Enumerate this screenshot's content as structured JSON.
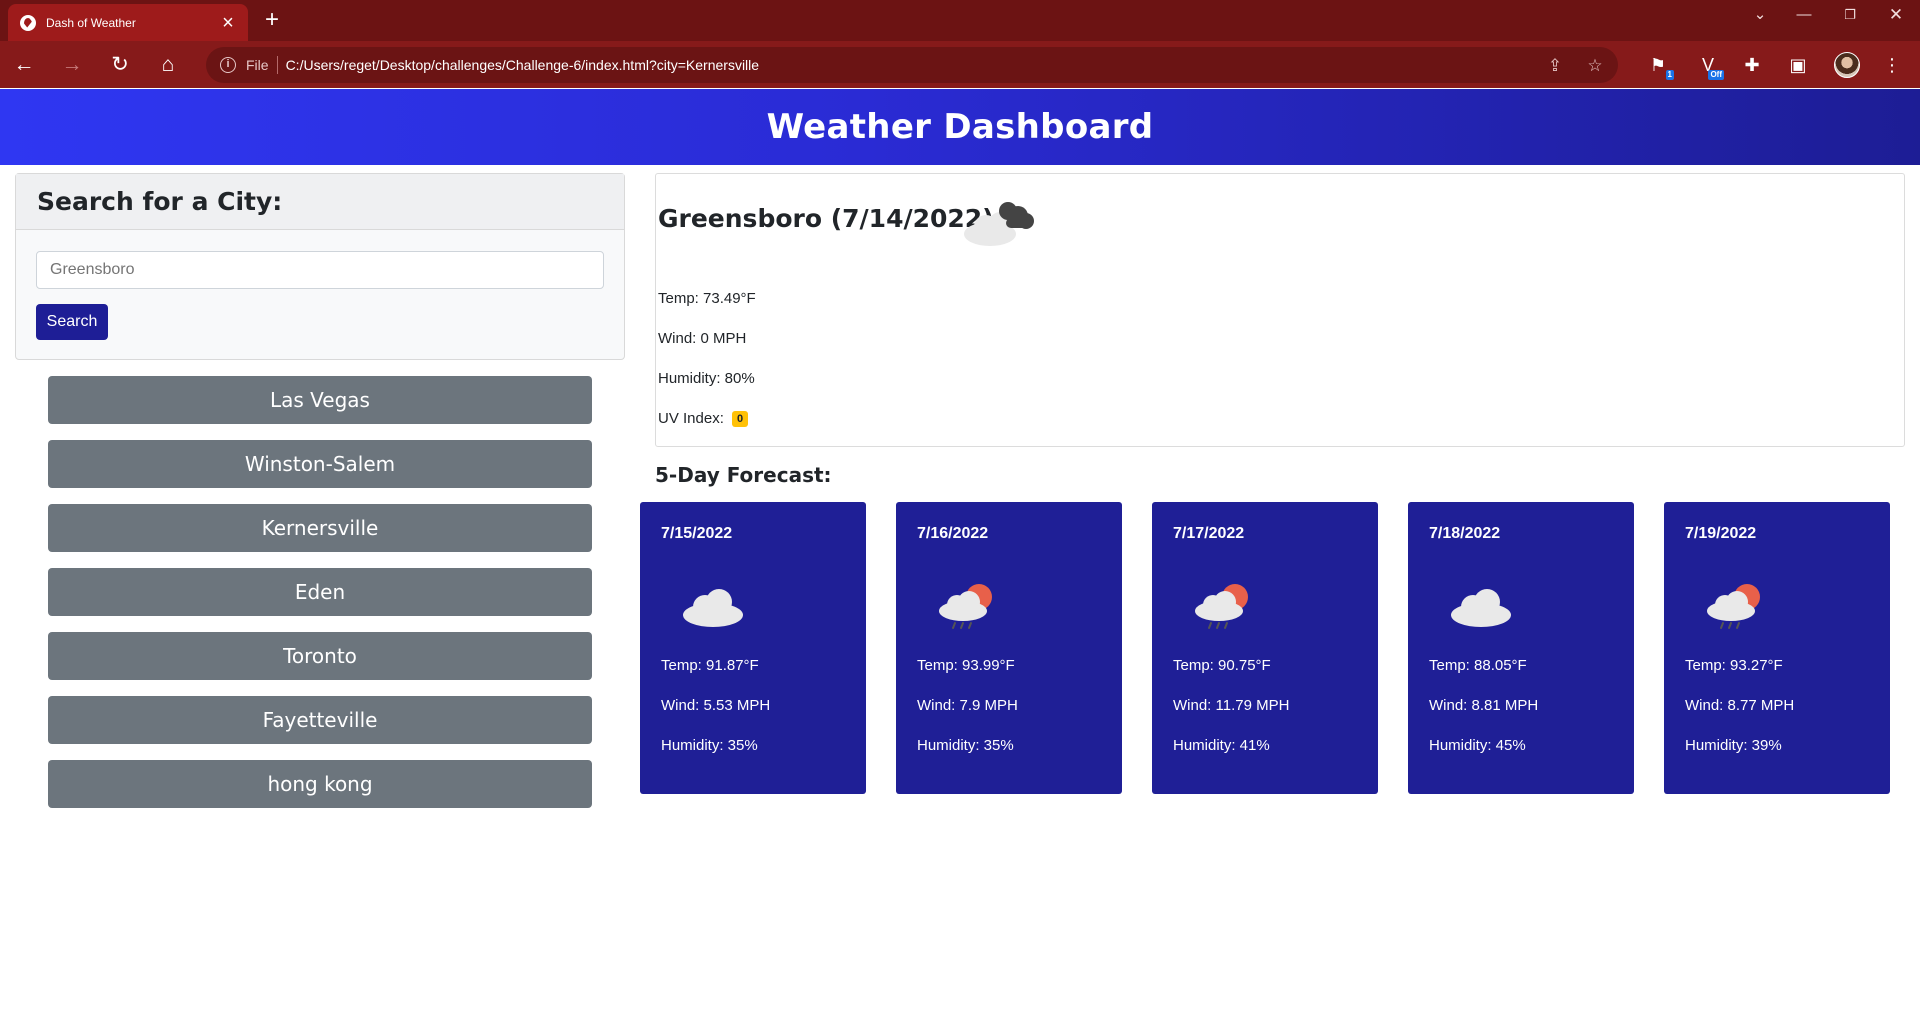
{
  "browser": {
    "tab_title": "Dash of Weather",
    "omnibox_prefix": "File",
    "url": "C:/Users/reget/Desktop/challenges/Challenge-6/index.html?city=Kernersville",
    "theme_color": "#861a1a"
  },
  "header": {
    "title": "Weather Dashboard"
  },
  "search": {
    "heading": "Search for a City:",
    "input_placeholder": "Greensboro",
    "button_label": "Search",
    "button_color": "#1e1e96"
  },
  "history": [
    "Las Vegas",
    "Winston-Salem",
    "Kernersville",
    "Eden",
    "Toronto",
    "Fayetteville",
    "hong kong"
  ],
  "current": {
    "heading": "Greensboro (7/14/2022)",
    "icon": "broken-clouds-icon",
    "temp": "Temp: 73.49°F",
    "wind": "Wind: 0 MPH",
    "humidity": "Humidity: 80%",
    "uv_label": "UV Index:",
    "uv_value": "0",
    "uv_color": "#ffc107"
  },
  "forecast": {
    "heading": "5-Day Forecast:",
    "card_color": "#1f1f96",
    "days": [
      {
        "date": "7/15/2022",
        "icon": "cloud-icon",
        "temp": "Temp: 91.87°F",
        "wind": "Wind: 5.53 MPH",
        "humidity": "Humidity: 35%"
      },
      {
        "date": "7/16/2022",
        "icon": "sun-rain-cloud-icon",
        "temp": "Temp: 93.99°F",
        "wind": "Wind: 7.9 MPH",
        "humidity": "Humidity: 35%"
      },
      {
        "date": "7/17/2022",
        "icon": "sun-rain-cloud-icon",
        "temp": "Temp: 90.75°F",
        "wind": "Wind: 11.79 MPH",
        "humidity": "Humidity: 41%"
      },
      {
        "date": "7/18/2022",
        "icon": "cloud-icon",
        "temp": "Temp: 88.05°F",
        "wind": "Wind: 8.81 MPH",
        "humidity": "Humidity: 45%"
      },
      {
        "date": "7/19/2022",
        "icon": "sun-rain-cloud-icon",
        "temp": "Temp: 93.27°F",
        "wind": "Wind: 8.77 MPH",
        "humidity": "Humidity: 39%"
      }
    ]
  }
}
